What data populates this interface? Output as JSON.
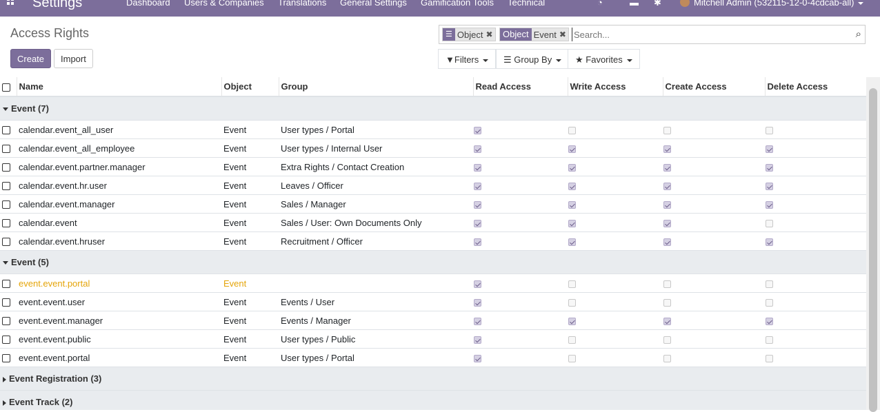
{
  "navbar": {
    "brand": "Settings",
    "menu": [
      "Dashboard",
      "Users & Companies",
      "Translations",
      "General Settings",
      "Gamification Tools",
      "Technical"
    ],
    "user": "Mitchell Admin (532115-12-0-4cdcab-all)"
  },
  "control_panel": {
    "title": "Access Rights",
    "create_label": "Create",
    "import_label": "Import",
    "facets": [
      {
        "label": "Object",
        "values": [
          "Object"
        ]
      },
      {
        "label": "Object",
        "values": [
          "Event"
        ]
      }
    ],
    "search_placeholder": "Search...",
    "filters_label": "Filters",
    "groupby_label": "Group By",
    "favorites_label": "Favorites"
  },
  "columns": [
    "Name",
    "Object",
    "Group",
    "Read Access",
    "Write Access",
    "Create Access",
    "Delete Access"
  ],
  "groups": [
    {
      "label": "Event (7)",
      "expanded": true,
      "rows": [
        {
          "name": "calendar.event_all_user",
          "object": "Event",
          "group": "User types / Portal",
          "access": [
            true,
            false,
            false,
            false
          ]
        },
        {
          "name": "calendar.event_all_employee",
          "object": "Event",
          "group": "User types / Internal User",
          "access": [
            true,
            true,
            true,
            true
          ]
        },
        {
          "name": "calendar.event.partner.manager",
          "object": "Event",
          "group": "Extra Rights / Contact Creation",
          "access": [
            true,
            true,
            true,
            true
          ]
        },
        {
          "name": "calendar.event.hr.user",
          "object": "Event",
          "group": "Leaves / Officer",
          "access": [
            true,
            true,
            true,
            true
          ]
        },
        {
          "name": "calendar.event.manager",
          "object": "Event",
          "group": "Sales / Manager",
          "access": [
            true,
            true,
            true,
            true
          ]
        },
        {
          "name": "calendar.event",
          "object": "Event",
          "group": "Sales / User: Own Documents Only",
          "access": [
            true,
            true,
            true,
            false
          ]
        },
        {
          "name": "calendar.event.hruser",
          "object": "Event",
          "group": "Recruitment / Officer",
          "access": [
            true,
            true,
            true,
            true
          ]
        }
      ]
    },
    {
      "label": "Event (5)",
      "expanded": true,
      "rows": [
        {
          "name": "event.event.portal",
          "object": "Event",
          "group": "",
          "access": [
            true,
            false,
            false,
            false
          ],
          "highlight": true
        },
        {
          "name": "event.event.user",
          "object": "Event",
          "group": "Events / User",
          "access": [
            true,
            false,
            false,
            false
          ]
        },
        {
          "name": "event.event.manager",
          "object": "Event",
          "group": "Events / Manager",
          "access": [
            true,
            true,
            true,
            true
          ]
        },
        {
          "name": "event.event.public",
          "object": "Event",
          "group": "User types / Public",
          "access": [
            true,
            false,
            false,
            false
          ]
        },
        {
          "name": "event.event.portal",
          "object": "Event",
          "group": "User types / Portal",
          "access": [
            true,
            false,
            false,
            false
          ]
        }
      ]
    },
    {
      "label": "Event Registration (3)",
      "expanded": false,
      "rows": []
    },
    {
      "label": "Event Track (2)",
      "expanded": false,
      "rows": []
    }
  ],
  "icons": {
    "apps": "apps-grid-icon",
    "activity": "activity-clock-icon",
    "messages": "chat-icon",
    "debug": "bug-icon",
    "search": "search-icon",
    "filter": "filter-icon",
    "groupby": "list-icon",
    "favorites": "star-icon"
  },
  "colors": {
    "primary": "#7c6e9b",
    "highlight_row": "#e5a50a",
    "group_bg": "#e9ecef"
  }
}
